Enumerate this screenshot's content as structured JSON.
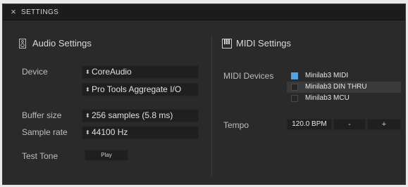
{
  "window": {
    "title": "SETTINGS",
    "close_glyph": "×"
  },
  "audio": {
    "section_title": "Audio Settings",
    "icon": "speaker-icon",
    "device_label": "Device",
    "device_value": "CoreAudio",
    "device2_value": "Pro Tools Aggregate I/O",
    "buffer_label": "Buffer size",
    "buffer_value": "256 samples (5.8 ms)",
    "sample_rate_label": "Sample rate",
    "sample_rate_value": "44100 Hz",
    "test_tone_label": "Test Tone",
    "play_label": "Play"
  },
  "midi": {
    "section_title": "MIDI Settings",
    "icon": "piano-keys-icon",
    "devices_label": "MIDI Devices",
    "devices": [
      {
        "name": "Minilab3 MIDI",
        "checked": true
      },
      {
        "name": "Minilab3 DIN THRU",
        "checked": false
      },
      {
        "name": "Minilab3 MCU",
        "checked": false
      }
    ],
    "tempo_label": "Tempo",
    "tempo_value": "120.0 BPM",
    "tempo_minus": "-",
    "tempo_plus": "+"
  },
  "colors": {
    "accent": "#4ea3e6",
    "background": "#2a2a2a",
    "titlebar": "#1c1c1c"
  }
}
